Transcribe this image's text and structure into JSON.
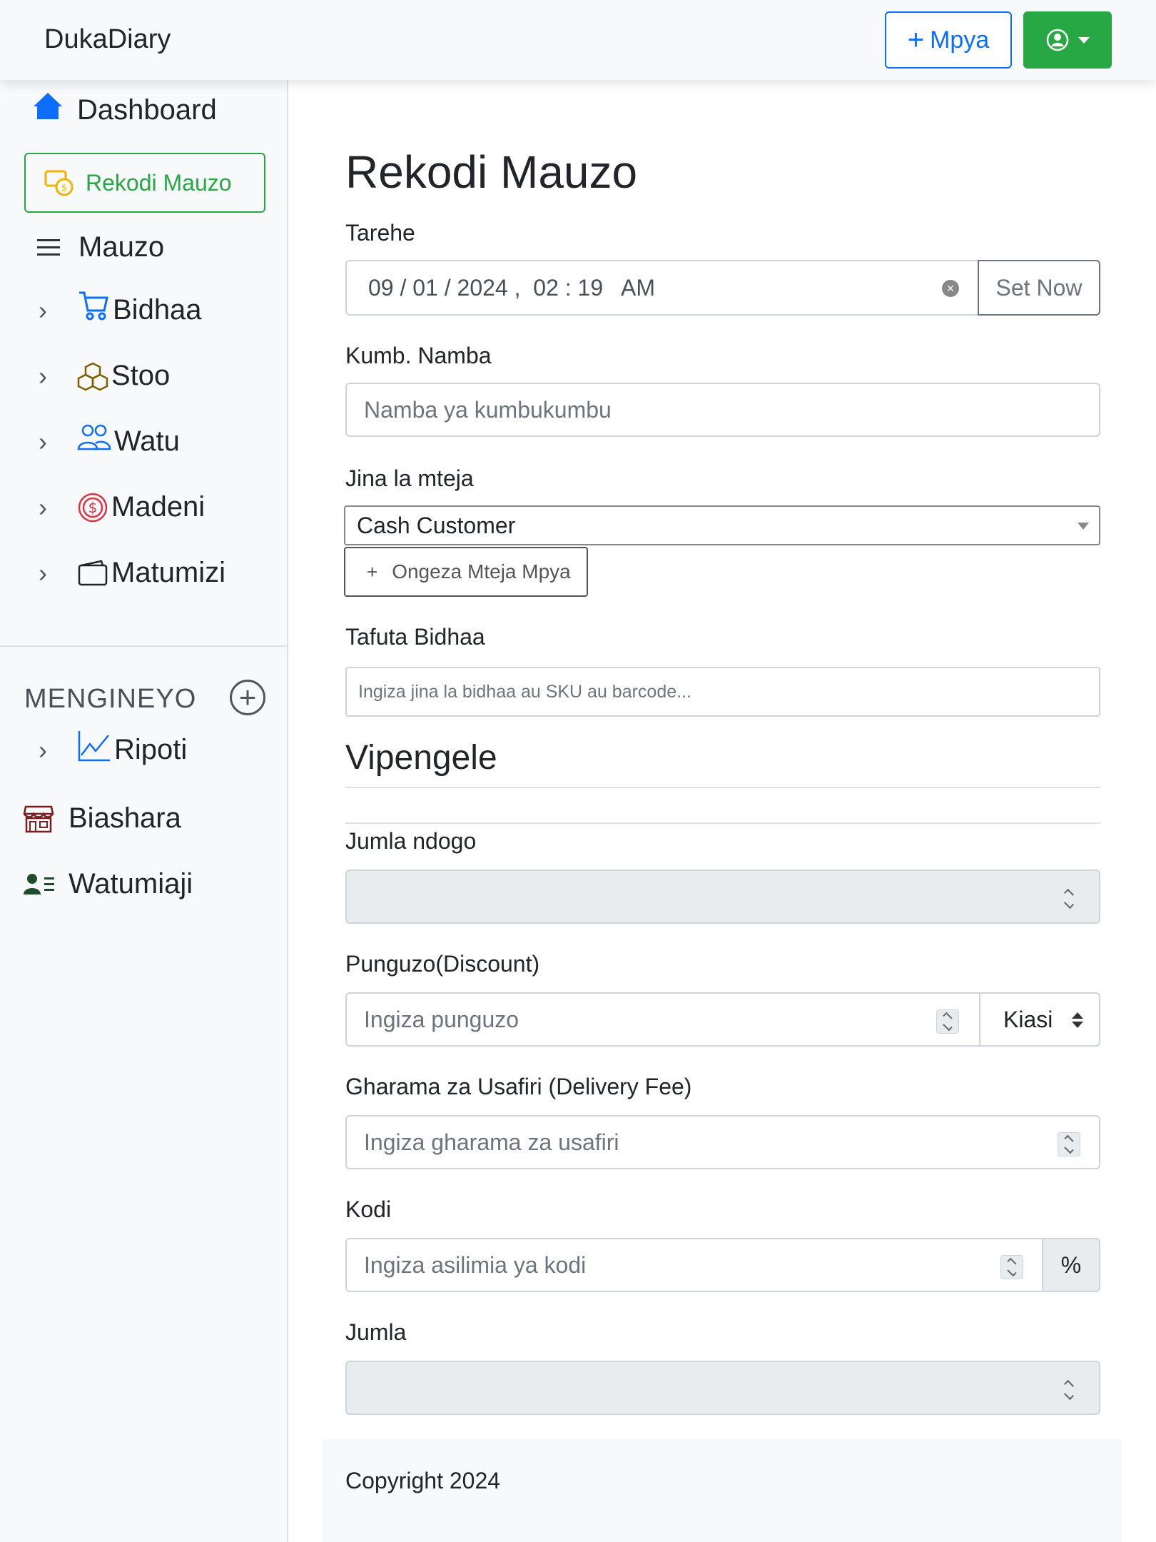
{
  "app": {
    "brand": "DukaDiary"
  },
  "navbar": {
    "new_label": "Mpya",
    "user_menu": "user-circle-icon"
  },
  "sidebar": {
    "dashboard": "Dashboard",
    "record_sales": "Rekodi Mauzo",
    "sales": "Mauzo",
    "items": [
      {
        "label": "Bidhaa",
        "icon": "cart-icon"
      },
      {
        "label": "Stoo",
        "icon": "boxes-icon"
      },
      {
        "label": "Watu",
        "icon": "people-icon"
      },
      {
        "label": "Madeni",
        "icon": "dollar-circle-icon"
      },
      {
        "label": "Matumizi",
        "icon": "wallet-icon"
      }
    ],
    "section_title": "MENGINEYO",
    "extra": [
      {
        "label": "Ripoti",
        "icon": "chart-line-icon"
      },
      {
        "label": "Biashara",
        "icon": "shop-icon"
      },
      {
        "label": "Watumiaji",
        "icon": "user-list-icon"
      }
    ]
  },
  "form": {
    "title": "Rekodi Mauzo",
    "date_label": "Tarehe",
    "date_value": "09 / 01 / 2024 ,  02 : 19   AM",
    "set_now": "Set Now",
    "ref_label": "Kumb. Namba",
    "ref_placeholder": "Namba ya kumbukumbu",
    "customer_label": "Jina la mteja",
    "customer_value": "Cash Customer",
    "add_customer": "Ongeza Mteja Mpya",
    "search_label": "Tafuta Bidhaa",
    "search_placeholder": "Ingiza jina la bidhaa au SKU au barcode...",
    "items_title": "Vipengele",
    "subtotal_label": "Jumla ndogo",
    "discount_label": "Punguzo(Discount)",
    "discount_placeholder": "Ingiza punguzo",
    "discount_type": "Kiasi",
    "delivery_label": "Gharama za Usafiri (Delivery Fee)",
    "delivery_placeholder": "Ingiza gharama za usafiri",
    "tax_label": "Kodi",
    "tax_placeholder": "Ingiza asilimia ya kodi",
    "tax_unit": "%",
    "total_label": "Jumla"
  },
  "footer": {
    "text": "Copyright 2024"
  },
  "colors": {
    "primary": "#0d6efd",
    "success": "#28a745",
    "sidebar_bg": "#f8f9fa"
  }
}
